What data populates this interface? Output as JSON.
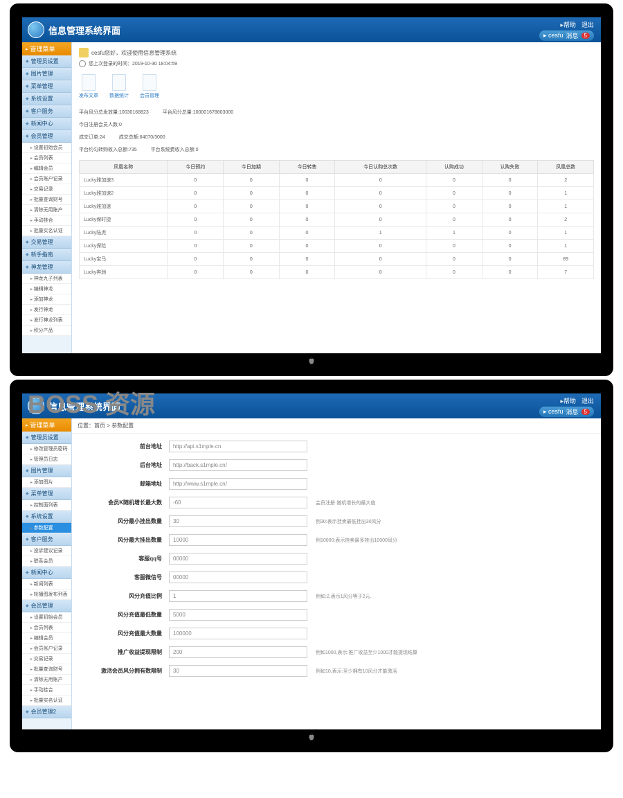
{
  "watermark": "BOSS 资源",
  "header": {
    "title": "信息管理系统界面",
    "help": "▸帮助",
    "logout": "退出",
    "user": "▸ cesfu",
    "msg_label": "消息",
    "msg_count": "5"
  },
  "screen1": {
    "menu_title": "管理菜单",
    "menu": [
      {
        "label": "管理员设置",
        "sub": []
      },
      {
        "label": "图片管理",
        "sub": []
      },
      {
        "label": "菜单管理",
        "sub": []
      },
      {
        "label": "系统设置",
        "sub": []
      },
      {
        "label": "客户服务",
        "sub": []
      },
      {
        "label": "新闻中心",
        "sub": []
      },
      {
        "label": "会员管理",
        "sub": [
          "设置初始会员",
          "会员列表",
          "编辑会员",
          "会员账户记录",
          "交易记录",
          "批量查询财号",
          "清除无用账户",
          "手动挂合",
          "批量实名认证"
        ]
      },
      {
        "label": "交易管理",
        "sub": []
      },
      {
        "label": "新手指南",
        "sub": []
      },
      {
        "label": "神龙管理",
        "sub": [
          "神龙九子列表",
          "编辑神龙",
          "添加神龙",
          "发行神龙",
          "发行神龙列表",
          "积分产品"
        ]
      }
    ],
    "welcome": "cesfu您好，欢迎使用信息管理系统",
    "last_login": "您上次登录的时间：2019-10-30 18:04:59",
    "shortcuts": [
      "发布文章",
      "数据统计",
      "会员管理"
    ],
    "stats": [
      [
        {
          "k": "平台风分总发放量",
          "v": "10030168823"
        },
        {
          "k": "平台风分总量",
          "v": "100001678803000"
        }
      ],
      [
        {
          "k": "今日注册会员人数",
          "v": "0"
        }
      ],
      [
        {
          "k": "成交订单",
          "v": "24"
        },
        {
          "k": "成交总额",
          "v": "64070/3000"
        }
      ],
      [
        {
          "k": "平台约匀转购收入总额",
          "v": "735"
        },
        {
          "k": "平台系统费收入总额",
          "v": "0"
        }
      ]
    ],
    "columns": [
      "凤凰名称",
      "今日预约",
      "今日加期",
      "今日转售",
      "今日认购总次数",
      "认购成功",
      "认购失败",
      "凤凰总数"
    ],
    "rows": [
      [
        "Lucky雅加速3",
        "0",
        "0",
        "0",
        "0",
        "0",
        "0",
        "2"
      ],
      [
        "Lucky雅加速2",
        "0",
        "0",
        "0",
        "0",
        "0",
        "0",
        "1"
      ],
      [
        "Lucky雅加速",
        "0",
        "0",
        "0",
        "0",
        "0",
        "0",
        "1"
      ],
      [
        "Lucky保时捷",
        "0",
        "0",
        "0",
        "0",
        "0",
        "0",
        "2"
      ],
      [
        "Lucky陆虎",
        "0",
        "0",
        "0",
        "1",
        "1",
        "0",
        "1"
      ],
      [
        "Lucky保险",
        "0",
        "0",
        "0",
        "0",
        "0",
        "0",
        "1"
      ],
      [
        "Lucky宝马",
        "0",
        "0",
        "0",
        "0",
        "0",
        "0",
        "89"
      ],
      [
        "Lucky奔驰",
        "0",
        "0",
        "0",
        "0",
        "0",
        "0",
        "7"
      ]
    ]
  },
  "screen2": {
    "menu_title": "管理菜单",
    "menu": [
      {
        "label": "管理员设置",
        "sub": [
          "修改管理员密码",
          "管理员日志"
        ]
      },
      {
        "label": "图片管理",
        "sub": [
          "添加图片"
        ]
      },
      {
        "label": "菜单管理",
        "sub": [
          "控制面列表"
        ]
      },
      {
        "label": "系统设置",
        "sub": [
          "参数配置"
        ],
        "active": 0
      },
      {
        "label": "客户服务",
        "sub": [
          "投诉建议记录",
          "联系会员"
        ]
      },
      {
        "label": "新闻中心",
        "sub": [
          "新闻列表",
          "轮播图发布列表"
        ]
      },
      {
        "label": "会员管理",
        "sub": [
          "设置初始会员",
          "会员列表",
          "编辑会员",
          "会员账户记录",
          "交易记录",
          "批量查询财号",
          "清除无用账户",
          "手动挂合",
          "批量实名认证"
        ]
      },
      {
        "label": "会员管理2",
        "sub": []
      }
    ],
    "breadcrumb": "位置：首页 > 参数配置",
    "form": [
      {
        "label": "前台地址",
        "value": "http://api.s1mple.cn",
        "hint": ""
      },
      {
        "label": "后台地址",
        "value": "http://back.s1mple.cn/",
        "hint": ""
      },
      {
        "label": "邮箱地址",
        "value": "http://www.s1mple.cn/",
        "hint": ""
      },
      {
        "label": "会员K随机增长最大数",
        "value": "-60",
        "hint": "会员注册·随机增长的最大值"
      },
      {
        "label": "风分最小挂出数量",
        "value": "30",
        "hint": "例30:表示挂卖最低挂出30风分"
      },
      {
        "label": "风分最大挂出数量",
        "value": "10000",
        "hint": "例10000:表示挂卖最多挂出10000风分"
      },
      {
        "label": "客服qq号",
        "value": "00000",
        "hint": ""
      },
      {
        "label": "客服微信号",
        "value": "00000",
        "hint": ""
      },
      {
        "label": "风分充值比例",
        "value": "1",
        "hint": "例如:2,表示1风分等于2元."
      },
      {
        "label": "风分充值最低数量",
        "value": "5000",
        "hint": ""
      },
      {
        "label": "风分充值最大数量",
        "value": "100000",
        "hint": ""
      },
      {
        "label": "推广收益提现限制",
        "value": "200",
        "hint": "例如1000,表示:推广收益至少1000才能提现结算"
      },
      {
        "label": "激活会员风分拥有数限制",
        "value": "30",
        "hint": "例如10,表示:至少拥有10风分才能激活"
      }
    ]
  }
}
